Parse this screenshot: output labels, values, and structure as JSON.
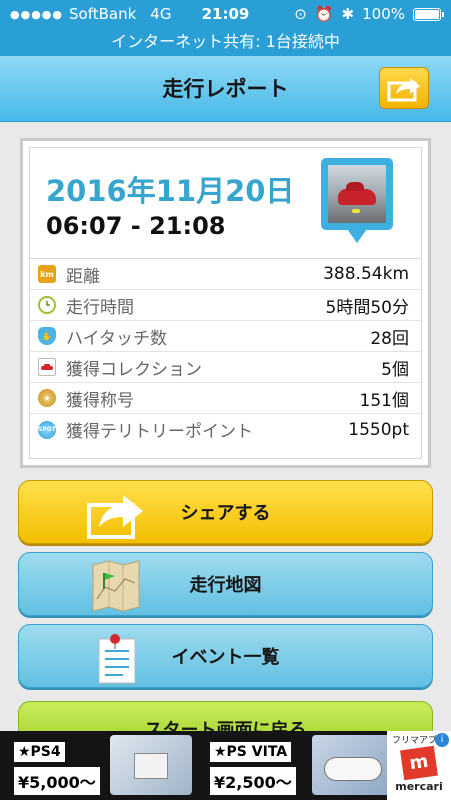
{
  "status": {
    "carrier": "SoftBank",
    "network": "4G",
    "time": "21:09",
    "battery": "100%"
  },
  "hotspot_banner": "インターネット共有: 1台接続中",
  "nav": {
    "title": "走行レポート"
  },
  "report": {
    "date": "2016年11月20日",
    "time_range": "06:07 - 21:08",
    "rows": [
      {
        "label": "距離",
        "value": "388.54km",
        "icon": "km-icon"
      },
      {
        "label": "走行時間",
        "value": "5時間50分",
        "icon": "clock-icon"
      },
      {
        "label": "ハイタッチ数",
        "value": "28回",
        "icon": "hand-icon"
      },
      {
        "label": "獲得コレクション",
        "value": "5個",
        "icon": "car-icon"
      },
      {
        "label": "獲得称号",
        "value": "151個",
        "icon": "medal-icon"
      },
      {
        "label": "獲得テリトリーポイント",
        "value": "1550pt",
        "icon": "spot-icon"
      }
    ]
  },
  "buttons": {
    "share": "シェアする",
    "map": "走行地図",
    "events": "イベント一覧",
    "start": "スタート画面に戻る"
  },
  "ad": {
    "item1_tag": "★PS4",
    "item1_price": "¥5,000〜",
    "item2_tag": "★PS VITA",
    "item2_price": "¥2,500〜",
    "brand_top": "フリマアプリ",
    "brand": "mercari"
  },
  "colors": {
    "accent_blue": "#2a9fd6",
    "date_blue": "#37a6cf",
    "share_yellow": "#f3be00",
    "start_green": "#a7d731"
  }
}
